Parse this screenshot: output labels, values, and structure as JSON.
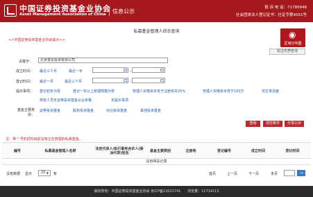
{
  "header": {
    "org_cn": "中国证券投资基金业协会",
    "org_en": "Asset Management Association of China",
    "pub_label": "信息公示",
    "hotline": "投  诉  电  话：71780948",
    "notice": "社会团体法人登记证书：社证字第4051号"
  },
  "page": {
    "title": "私募基金管理人综合查询",
    "back_link": "<<中国证券投资基金业协会提示>>",
    "map_button": "区域分布图",
    "std_button": "标注形势查询"
  },
  "form": {
    "keyword_label": "关键字：",
    "keyword_value": "北京普思投资有限公司",
    "established_label": "成立时间：",
    "established_options": [
      "最近三个月",
      "最近一年"
    ],
    "registered_label": "登记时间：",
    "registered_options": [
      "最近一月",
      "最近三个月"
    ],
    "range_dash": "－",
    "tips_label": "提示事项：",
    "tips": [
      "登记初年为零",
      "登记一年以上管理规模为零",
      "管理人实缴资本低于注册资本25%",
      "管理人实缴资本低于100万",
      "非正常清盘",
      "高管人员无证券投资基金从业资格",
      "无提示事项"
    ],
    "fund_type_label": "基金主要类别：",
    "fund_types": [
      "证券投资基金",
      "股权投资基金",
      "创业投资基金",
      "其他投资基金"
    ]
  },
  "actions": {
    "query": "查询",
    "clear": "清空条件",
    "share": "分享公示"
  },
  "table": {
    "notice": "注：带 * 号的机构目前没有正在管理的私募基金。",
    "headers": [
      "编号",
      "私募基金管理人名称",
      "法定代表人/执行事务合伙人(委派代表)姓名",
      "基金主要类别",
      "注册地",
      "登记编号",
      "成立时间",
      "登记时间"
    ],
    "empty_text": "没有相关记录"
  },
  "pagination": {
    "total_prefix": "没有数据",
    "show_label": "显示",
    "page_size": "20",
    "unit": "条",
    "first": "首页",
    "prev": "上一页",
    "next": "下一页",
    "last": "末页",
    "go": "→"
  },
  "footer": {
    "copyright": "版权所有：中国证券投资基金业协会 京ICP备12021741",
    "visits": "浏览量：11714113"
  }
}
